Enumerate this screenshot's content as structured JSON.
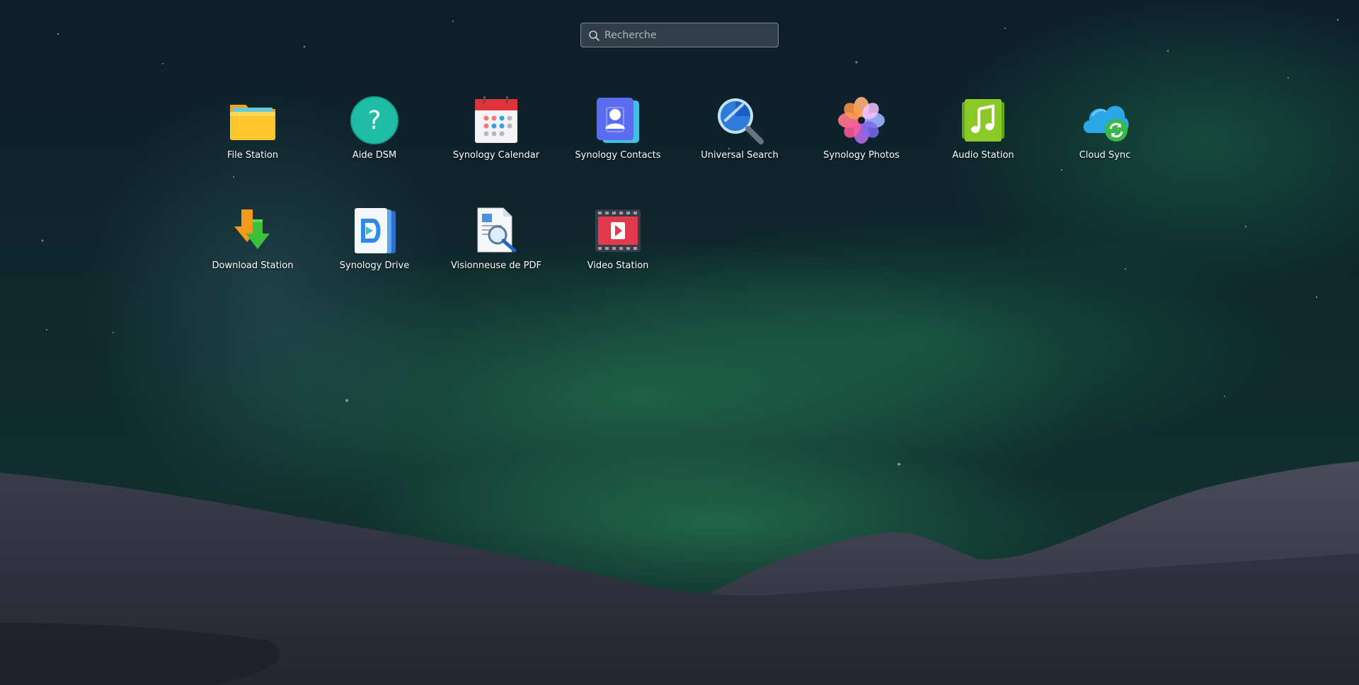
{
  "search": {
    "placeholder": "Recherche"
  },
  "apps": [
    {
      "id": "file-station",
      "label": "File Station",
      "icon": "folder-icon"
    },
    {
      "id": "aide-dsm",
      "label": "Aide DSM",
      "icon": "help-icon"
    },
    {
      "id": "synology-calendar",
      "label": "Synology Calendar",
      "icon": "calendar-icon"
    },
    {
      "id": "synology-contacts",
      "label": "Synology Contacts",
      "icon": "contacts-icon"
    },
    {
      "id": "universal-search",
      "label": "Universal Search",
      "icon": "magnifier-icon"
    },
    {
      "id": "synology-photos",
      "label": "Synology Photos",
      "icon": "photos-flower-icon"
    },
    {
      "id": "audio-station",
      "label": "Audio Station",
      "icon": "music-note-icon"
    },
    {
      "id": "cloud-sync",
      "label": "Cloud Sync",
      "icon": "cloud-sync-icon"
    },
    {
      "id": "download-station",
      "label": "Download Station",
      "icon": "download-arrows-icon"
    },
    {
      "id": "synology-drive",
      "label": "Synology Drive",
      "icon": "drive-icon"
    },
    {
      "id": "pdf-viewer",
      "label": "Visionneuse de PDF",
      "icon": "pdf-viewer-icon"
    },
    {
      "id": "video-station",
      "label": "Video Station",
      "icon": "video-film-icon"
    }
  ],
  "colors": {
    "sky": "#0b1a24",
    "aurora": "#1f6b4a",
    "snow": "#2a2d3d",
    "label_text": "#ffffff"
  }
}
